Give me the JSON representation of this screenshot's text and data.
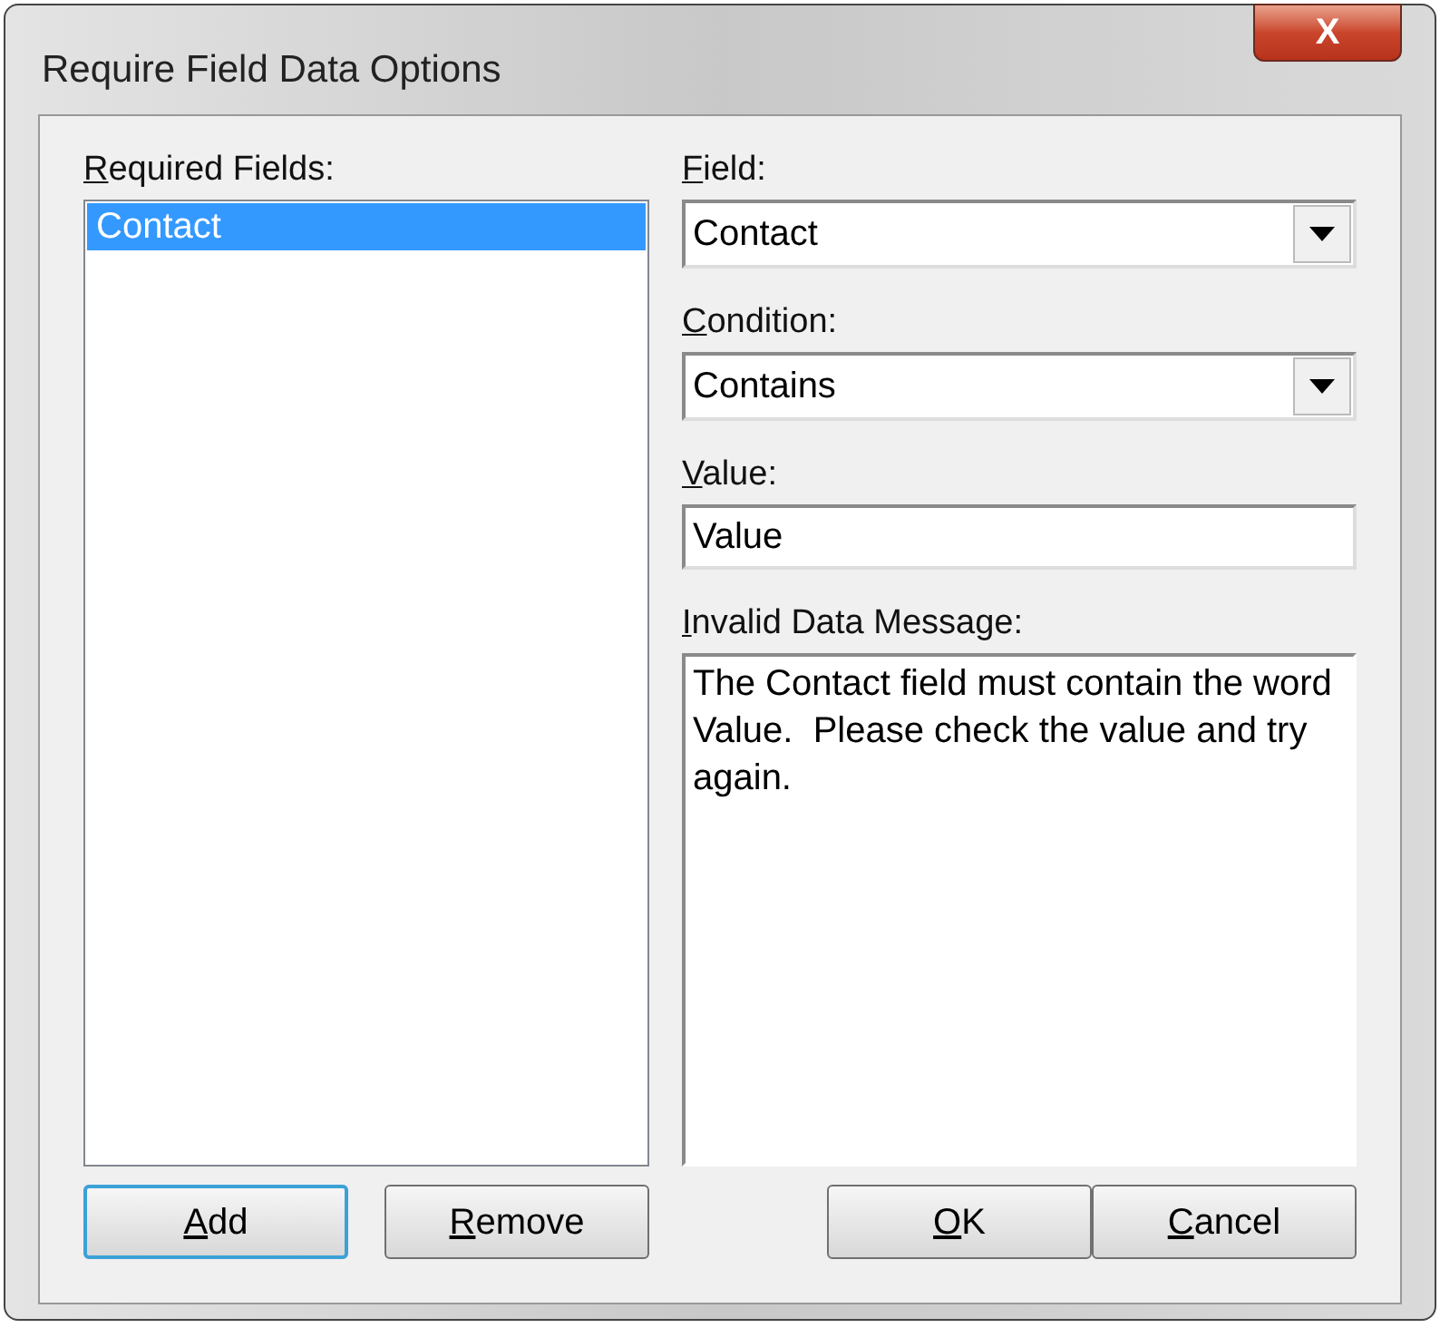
{
  "window": {
    "title": "Require Field Data Options",
    "close_button": "X"
  },
  "required_fields": {
    "label": "Required Fields:",
    "items": [
      {
        "text": "Contact",
        "selected": true
      }
    ]
  },
  "field": {
    "label": "Field:",
    "value": "Contact"
  },
  "condition": {
    "label": "Condition:",
    "value": "Contains"
  },
  "value_field": {
    "label": "Value:",
    "value": "Value"
  },
  "message": {
    "label": "Invalid Data Message:",
    "value": "The Contact field must contain the word Value.  Please check the value and try again."
  },
  "left_buttons": [
    {
      "label": "Add",
      "default": true
    },
    {
      "label": "Remove",
      "default": false
    }
  ],
  "right_buttons": [
    {
      "label": "OK",
      "default": false
    },
    {
      "label": "Cancel",
      "default": false
    }
  ]
}
